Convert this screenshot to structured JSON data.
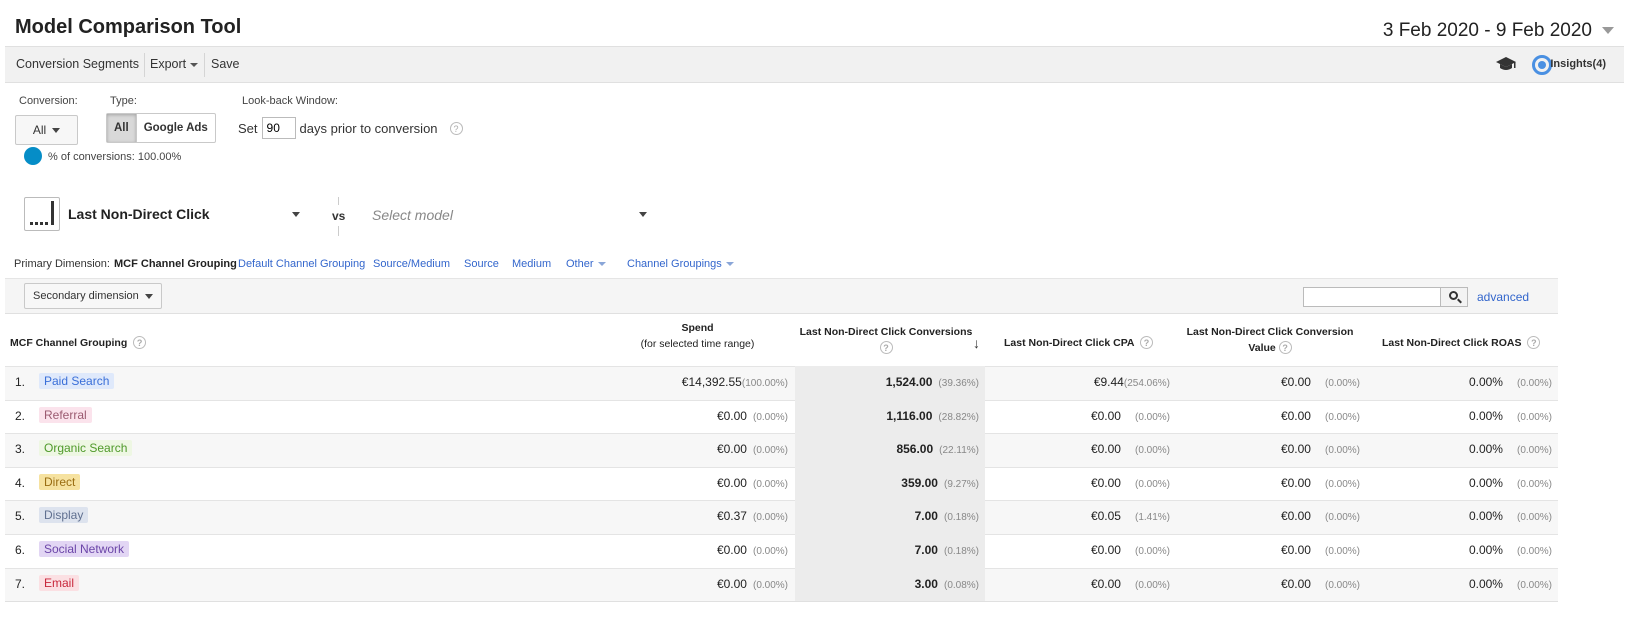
{
  "header": {
    "title": "Model Comparison Tool",
    "date_range": "3 Feb 2020 - 9 Feb 2020"
  },
  "toolbar": {
    "segments": "Conversion Segments",
    "export": "Export",
    "save": "Save",
    "insights": "Insights(4)"
  },
  "filters": {
    "conversion_label": "Conversion:",
    "conversion_value": "All",
    "type_label": "Type:",
    "type_options": [
      "All",
      "Google Ads"
    ],
    "lookback_label": "Look-back Window:",
    "lookback_set": "Set",
    "lookback_days": "90",
    "lookback_suffix": "days prior to conversion",
    "pct_conversions": "% of conversions: 100.00%"
  },
  "models": {
    "primary": "Last Non-Direct Click",
    "vs": "vs",
    "secondary_placeholder": "Select model"
  },
  "dimensions": {
    "label": "Primary Dimension:",
    "active": "MCF Channel Grouping",
    "links": [
      "Default Channel Grouping",
      "Source/Medium",
      "Source",
      "Medium",
      "Other",
      "Channel Groupings"
    ]
  },
  "secondary": {
    "label": "Secondary dimension",
    "advanced": "advanced"
  },
  "table": {
    "headers": {
      "dim": "MCF Channel Grouping",
      "spend": "Spend",
      "spend_sub": "(for selected time range)",
      "conversions": "Last Non-Direct Click Conversions",
      "cpa": "Last Non-Direct Click CPA",
      "value_l1": "Last Non-Direct Click Conversion",
      "value_l2": "Value",
      "roas": "Last Non-Direct Click ROAS"
    },
    "rows": [
      {
        "num": "1.",
        "channel": "Paid Search",
        "bg": "#dfe9fb",
        "fg": "#3a6fd8",
        "spend": "€14,392.55",
        "spend_pct": "(100.00%)",
        "conv": "1,524.00",
        "conv_pct": "(39.36%)",
        "cpa": "€9.44",
        "cpa_pct": "(254.06%)",
        "val": "€0.00",
        "val_pct": "(0.00%)",
        "roas": "0.00%",
        "roas_pct": "(0.00%)"
      },
      {
        "num": "2.",
        "channel": "Referral",
        "bg": "#fbe3ec",
        "fg": "#9b5a70",
        "spend": "€0.00",
        "spend_pct": "(0.00%)",
        "conv": "1,116.00",
        "conv_pct": "(28.82%)",
        "cpa": "€0.00",
        "cpa_pct": "(0.00%)",
        "val": "€0.00",
        "val_pct": "(0.00%)",
        "roas": "0.00%",
        "roas_pct": "(0.00%)"
      },
      {
        "num": "3.",
        "channel": "Organic Search",
        "bg": "#eef7e3",
        "fg": "#4f9a2a",
        "spend": "€0.00",
        "spend_pct": "(0.00%)",
        "conv": "856.00",
        "conv_pct": "(22.11%)",
        "cpa": "€0.00",
        "cpa_pct": "(0.00%)",
        "val": "€0.00",
        "val_pct": "(0.00%)",
        "roas": "0.00%",
        "roas_pct": "(0.00%)"
      },
      {
        "num": "4.",
        "channel": "Direct",
        "bg": "#f6e2a0",
        "fg": "#9a6d12",
        "spend": "€0.00",
        "spend_pct": "(0.00%)",
        "conv": "359.00",
        "conv_pct": "(9.27%)",
        "cpa": "€0.00",
        "cpa_pct": "(0.00%)",
        "val": "€0.00",
        "val_pct": "(0.00%)",
        "roas": "0.00%",
        "roas_pct": "(0.00%)"
      },
      {
        "num": "5.",
        "channel": "Display",
        "bg": "#dde3ee",
        "fg": "#607090",
        "spend": "€0.37",
        "spend_pct": "(0.00%)",
        "conv": "7.00",
        "conv_pct": "(0.18%)",
        "cpa": "€0.05",
        "cpa_pct": "(1.41%)",
        "val": "€0.00",
        "val_pct": "(0.00%)",
        "roas": "0.00%",
        "roas_pct": "(0.00%)"
      },
      {
        "num": "6.",
        "channel": "Social Network",
        "bg": "#e2d6f4",
        "fg": "#6b45a8",
        "spend": "€0.00",
        "spend_pct": "(0.00%)",
        "conv": "7.00",
        "conv_pct": "(0.18%)",
        "cpa": "€0.00",
        "cpa_pct": "(0.00%)",
        "val": "€0.00",
        "val_pct": "(0.00%)",
        "roas": "0.00%",
        "roas_pct": "(0.00%)"
      },
      {
        "num": "7.",
        "channel": "Email",
        "bg": "#fbe0e3",
        "fg": "#c8283c",
        "spend": "€0.00",
        "spend_pct": "(0.00%)",
        "conv": "3.00",
        "conv_pct": "(0.08%)",
        "cpa": "€0.00",
        "cpa_pct": "(0.00%)",
        "val": "€0.00",
        "val_pct": "(0.00%)",
        "roas": "0.00%",
        "roas_pct": "(0.00%)"
      }
    ]
  }
}
